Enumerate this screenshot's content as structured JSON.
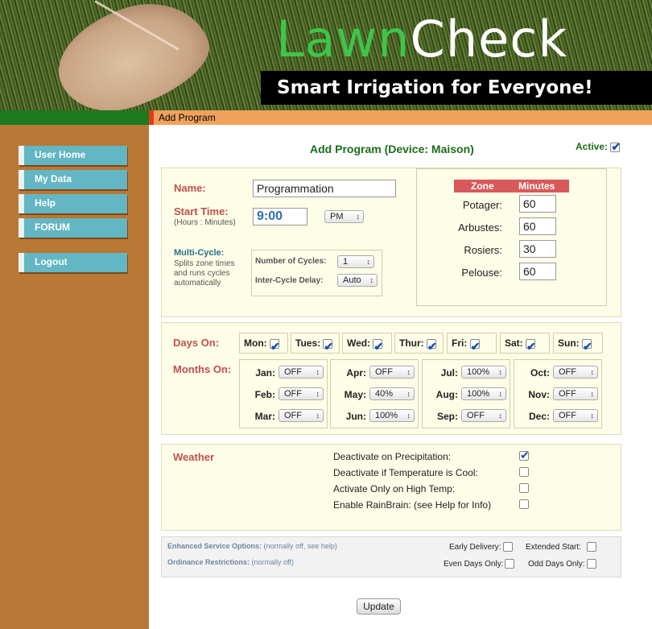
{
  "header": {
    "logo_part1": "Lawn",
    "logo_part2": "Check",
    "tagline": "Smart Irrigation for Everyone!"
  },
  "breadcrumb": "Add Program",
  "sidebar": {
    "items": [
      {
        "label": "User Home"
      },
      {
        "label": "My Data"
      },
      {
        "label": "Help"
      },
      {
        "label": "FORUM"
      },
      {
        "label": "Logout"
      }
    ]
  },
  "page": {
    "title": "Add Program (Device: Maison)",
    "active_label": "Active:",
    "active_checked": true
  },
  "program": {
    "name_label": "Name:",
    "name_value": "Programmation",
    "start_label": "Start Time:",
    "start_hint": "(Hours : Minutes)",
    "start_value": "9:00",
    "ampm": "PM",
    "multicycle_label": "Multi-Cycle:",
    "multicycle_desc_1": "Splits zone times",
    "multicycle_desc_2": "and runs cycles",
    "multicycle_desc_3": "automatically",
    "cycles_label": "Number of Cycles:",
    "cycles_value": "1",
    "delay_label": "Inter-Cycle Delay:",
    "delay_value": "Auto"
  },
  "zones": {
    "col_zone": "Zone",
    "col_minutes": "Minutes",
    "rows": [
      {
        "name": "Potager:",
        "minutes": "60"
      },
      {
        "name": "Arbustes:",
        "minutes": "60"
      },
      {
        "name": "Rosiers:",
        "minutes": "30"
      },
      {
        "name": "Pelouse:",
        "minutes": "60"
      }
    ]
  },
  "days": {
    "label": "Days On:",
    "items": [
      {
        "label": "Mon:",
        "checked": true
      },
      {
        "label": "Tues:",
        "checked": true
      },
      {
        "label": "Wed:",
        "checked": true
      },
      {
        "label": "Thur:",
        "checked": true
      },
      {
        "label": "Fri:",
        "checked": true
      },
      {
        "label": "Sat:",
        "checked": true
      },
      {
        "label": "Sun:",
        "checked": true
      }
    ]
  },
  "months": {
    "label": "Months On:",
    "items": [
      {
        "label": "Jan:",
        "value": "OFF"
      },
      {
        "label": "Feb:",
        "value": "OFF"
      },
      {
        "label": "Mar:",
        "value": "OFF"
      },
      {
        "label": "Apr:",
        "value": "OFF"
      },
      {
        "label": "May:",
        "value": "40%"
      },
      {
        "label": "Jun:",
        "value": "100%"
      },
      {
        "label": "Jul:",
        "value": "100%"
      },
      {
        "label": "Aug:",
        "value": "100%"
      },
      {
        "label": "Sep:",
        "value": "OFF"
      },
      {
        "label": "Oct:",
        "value": "OFF"
      },
      {
        "label": "Nov:",
        "value": "OFF"
      },
      {
        "label": "Dec:",
        "value": "OFF"
      }
    ]
  },
  "weather": {
    "label": "Weather",
    "options": [
      {
        "label": "Deactivate on Precipitation:",
        "checked": true
      },
      {
        "label": "Deactivate if Temperature is Cool:",
        "checked": false
      },
      {
        "label": "Activate Only on High Temp:",
        "checked": false
      },
      {
        "label": "Enable RainBrain: (see Help for Info)",
        "checked": false
      }
    ]
  },
  "enhanced": {
    "service_label": "Enhanced Service Options:",
    "service_note": "(normally off, see help)",
    "ordinance_label": "Ordinance Restrictions:",
    "ordinance_note": "(normally off)",
    "early_delivery": "Early Delivery:",
    "extended_start": "Extended Start:",
    "even_days": "Even Days Only:",
    "odd_days": "Odd Days Only:"
  },
  "update_label": "Update",
  "colors": {
    "sidebar_bg": "#b97835",
    "nav_button": "#63b6c4",
    "title_green": "#1b6c1b",
    "label_red": "#c0504d",
    "zone_header": "#d9595a",
    "panel_bg": "#fdfde8"
  }
}
